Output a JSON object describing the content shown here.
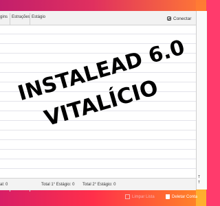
{
  "columns": {
    "col1": "gins",
    "col2": "Estrações",
    "col3": "Estágio"
  },
  "connect": {
    "label": "Conectar",
    "icon": "instagram-icon"
  },
  "status": {
    "left": "al: 0",
    "stage1": "Total 1° Estágio: 0",
    "stage2": "Total 2° Estágio: 0"
  },
  "actions": {
    "clear": "Limpar Lista",
    "delete": "Deletar Conta"
  },
  "overlay": {
    "line1": "INSTALEAD 6.0",
    "line2": "VITALÍCIO"
  },
  "right_panel": {
    "t1": "T",
    "t2": "T"
  },
  "colors": {
    "brand_left": "#c21f6b",
    "brand_right": "#ff7a34",
    "overlay_text": "#000000"
  }
}
